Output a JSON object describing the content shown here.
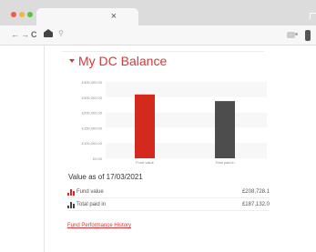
{
  "browser": {
    "tab_close": "×",
    "nav": {
      "back": "←",
      "forward": "→",
      "reload": "C"
    },
    "address_search_glyph": "⚲",
    "icons": [
      "close-icon",
      "back-icon",
      "forward-icon",
      "reload-icon",
      "home-icon",
      "search-icon",
      "extension-icon",
      "profile-icon"
    ]
  },
  "balance": {
    "title": "My DC Balance",
    "value_as_of": "Value as of 17/03/2021",
    "rows": [
      {
        "label": "Fund value",
        "value": "£208,728.1",
        "icon": "bar-chart-icon",
        "color": "#d42a1e"
      },
      {
        "label": "Total paid in",
        "value": "£187,132.0",
        "icon": "bar-chart-icon",
        "color": "#444444"
      }
    ],
    "performance_link": "Fund Performance History"
  },
  "chart_data": {
    "type": "bar",
    "categories": [
      "Fund value",
      "Total paid in"
    ],
    "values": [
      208728.1,
      187132.0
    ],
    "colors": [
      "#d42a1e",
      "#4d4d4d"
    ],
    "y_tick_labels": [
      "£400,000.00",
      "£300,000.00",
      "£200,000.00",
      "£150,000.00",
      "£100,000.00",
      "£0.00"
    ],
    "title": "",
    "xlabel": "",
    "ylabel": "",
    "grid": true,
    "legend": "none"
  }
}
